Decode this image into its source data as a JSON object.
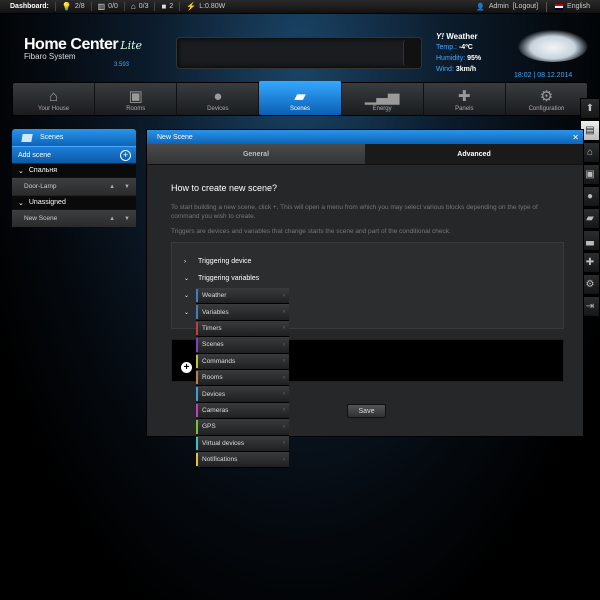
{
  "statusbar": {
    "label": "Dashboard:",
    "stats": [
      {
        "icon": "lightbulb-icon",
        "glyph": "💡",
        "value": "2/8"
      },
      {
        "icon": "blind-icon",
        "glyph": "▥",
        "value": "0/0"
      },
      {
        "icon": "door-icon",
        "glyph": "⌂",
        "value": "0/3"
      },
      {
        "icon": "alarm-icon",
        "glyph": "■",
        "value": "2"
      },
      {
        "icon": "power-icon",
        "glyph": "⚡",
        "value": "L:0.80W"
      }
    ],
    "user": "Admin",
    "logout": "[Logout]",
    "language": "English"
  },
  "header": {
    "title": "Home Center",
    "lite": "Lite",
    "subtitle": "Fibaro System",
    "version": "3.593"
  },
  "weather": {
    "title": "Weather",
    "provider_mark": "Y!",
    "temp_label": "Temp.:",
    "temp_value": "-4ºC",
    "humidity_label": "Humidity:",
    "humidity_value": "95%",
    "wind_label": "Wind:",
    "wind_value": "3km/h",
    "datetime": "18:02 | 08.12.2014"
  },
  "nav": {
    "tabs": [
      {
        "label": "Your House",
        "icon": "house-icon",
        "glyph": "⌂",
        "active": false
      },
      {
        "label": "Rooms",
        "icon": "rooms-icon",
        "glyph": "▣",
        "active": false
      },
      {
        "label": "Devices",
        "icon": "bulb-icon",
        "glyph": "●",
        "active": false
      },
      {
        "label": "Scenes",
        "icon": "clapper-icon",
        "glyph": "▰",
        "active": true
      },
      {
        "label": "Energy",
        "icon": "energy-chart-icon",
        "glyph": "▁▃▅",
        "active": false
      },
      {
        "label": "Panels",
        "icon": "panels-icon",
        "glyph": "✚",
        "active": false
      },
      {
        "label": "Configuration",
        "icon": "gears-icon",
        "glyph": "⚙",
        "active": false
      }
    ]
  },
  "sidebar": {
    "title": "Scenes",
    "add_scene": "Add scene",
    "groups": [
      {
        "room": "Спальня",
        "scenes": [
          "Door-Lamp"
        ]
      },
      {
        "room": "Unassigned",
        "scenes": [
          "New Scene"
        ]
      }
    ]
  },
  "panel": {
    "title": "New Scene",
    "tabs": [
      "General",
      "Advanced"
    ],
    "heading": "How to create new scene?",
    "para1": "To start building a new scene, click +. This will open a menu from which you may select various blocks depending on the type of command you wish to create.",
    "para2": "Triggers are devices and variables that change starts the scene and part of the conditional check.",
    "triggers": [
      "Triggering device",
      "Triggering variables"
    ],
    "save": "Save"
  },
  "menu": {
    "items": [
      {
        "label": "Weather",
        "color": "#3f7fbf"
      },
      {
        "label": "Variables",
        "color": "#3f7fbf"
      },
      {
        "label": "Timers",
        "color": "#bf3f3f"
      },
      {
        "label": "Scenes",
        "color": "#7f3fbf"
      },
      {
        "label": "Commands",
        "color": "#bfbf3f"
      },
      {
        "label": "Rooms",
        "color": "#bf7f3f"
      },
      {
        "label": "Devices",
        "color": "#3f9fdf"
      },
      {
        "label": "Cameras",
        "color": "#bf3fbf"
      },
      {
        "label": "GPS",
        "color": "#7fbf3f"
      },
      {
        "label": "Virtual devices",
        "color": "#3fbfbf"
      },
      {
        "label": "Notifications",
        "color": "#dfbf3f"
      }
    ]
  },
  "sidetools": [
    {
      "icon": "scroll-up-icon",
      "glyph": "⬆"
    },
    {
      "icon": "save-icon",
      "glyph": "▤",
      "active": true
    },
    {
      "icon": "house-icon",
      "glyph": "⌂"
    },
    {
      "icon": "rooms-icon",
      "glyph": "▣"
    },
    {
      "icon": "bulb-icon",
      "glyph": "●"
    },
    {
      "icon": "clapper-icon",
      "glyph": "▰"
    },
    {
      "icon": "energy-chart-icon",
      "glyph": "▃"
    },
    {
      "icon": "panels-icon",
      "glyph": "✚"
    },
    {
      "icon": "gears-icon",
      "glyph": "⚙"
    },
    {
      "icon": "logout-icon",
      "glyph": "⇥"
    }
  ]
}
